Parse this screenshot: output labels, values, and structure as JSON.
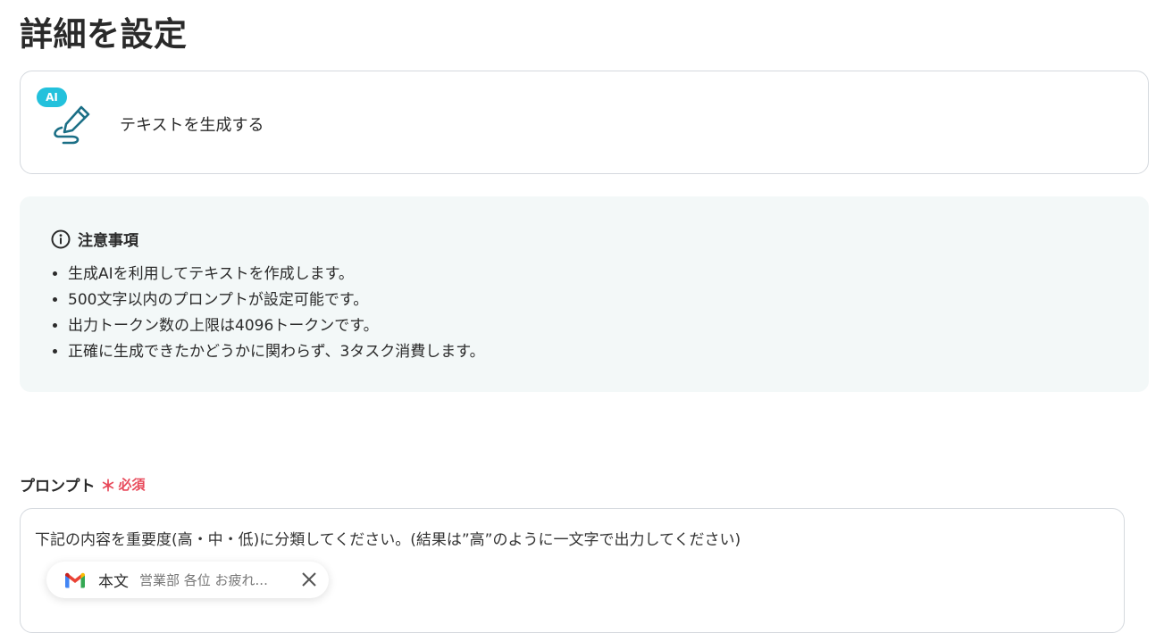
{
  "page": {
    "title": "詳細を設定"
  },
  "action": {
    "badge": "AI",
    "label": "テキストを生成する"
  },
  "notice": {
    "title": "注意事項",
    "items": [
      "生成AIを利用してテキストを作成します。",
      "500文字以内のプロンプトが設定可能です。",
      "出力トークン数の上限は4096トークンです。",
      "正確に生成できたかどうかに関わらず、3タスク消費します。"
    ]
  },
  "prompt_field": {
    "label": "プロンプト",
    "required_mark": "＊",
    "required_text": "必須",
    "value": "下記の内容を重要度(高・中・低)に分類してください。(結果は”高”のように一文字で出力してください)",
    "chip": {
      "field_name": "本文",
      "preview": "営業部 各位 お疲れ..."
    }
  },
  "colors": {
    "accent_cyan": "#23c1dc",
    "icon_teal": "#1b6f86",
    "required_red": "#e8495a",
    "notice_bg": "#f3f8f8"
  },
  "icons": {
    "action": "ai-pen-icon",
    "notice": "info-icon",
    "chip_service": "gmail-icon",
    "chip_remove": "close-icon"
  }
}
